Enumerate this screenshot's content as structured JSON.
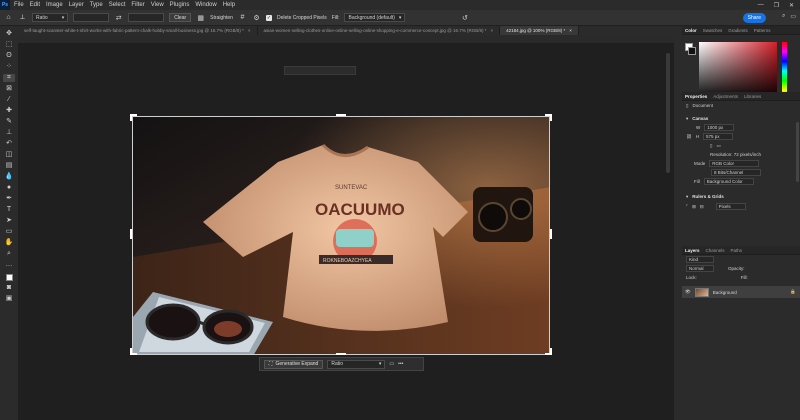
{
  "menubar": {
    "logo": "Ps",
    "items": [
      "File",
      "Edit",
      "Image",
      "Layer",
      "Type",
      "Select",
      "Filter",
      "View",
      "Plugins",
      "Window",
      "Help"
    ],
    "controls": [
      "—",
      "❐",
      "✕"
    ]
  },
  "options": {
    "ratio_label": "Ratio",
    "clear_label": "Clear",
    "straighten_label": "Straighten",
    "delete_cropped_label": "Delete Cropped Pixels",
    "fill_label": "Fill:",
    "fill_value": "Background (default)",
    "share_label": "Share"
  },
  "tabs": [
    {
      "label": "self-taught-scanster-white-t-shirt-works-with-fabric-pattern-chalk-hobby-small-business.jpg @ 16.7% (RGB/8) *",
      "active": false
    },
    {
      "label": "asian-women-selling-clothes-online-online-selling-online-shopping-e-commerce-concept.jpg @ 16.7% (RGB/8) *",
      "active": false
    },
    {
      "label": "42184.jpg @ 100% (RGB/8) *",
      "active": true
    }
  ],
  "tab_close": "×",
  "canvas": {
    "shirt_text_top": "SUNTEVAC",
    "shirt_text_main": "OACUUMO",
    "shirt_text_band": "ROKNEBOAZCHYEA"
  },
  "genbar": {
    "button_label": "Generative Expand",
    "ratio_value": "Ratio",
    "more": "•••"
  },
  "panels": {
    "color_tabs": [
      "Color",
      "Swatches",
      "Gradients",
      "Patterns"
    ],
    "props_tabs": [
      "Properties",
      "Adjustments",
      "Libraries"
    ],
    "document_label": "Document",
    "canvas_header": "Canvas",
    "width_label": "W",
    "width_value": "1000 px",
    "height_label": "H",
    "height_value": "575 px",
    "resolution": "Resolution: 72 pixels/inch",
    "mode_label": "Mode",
    "mode_value": "RGB Color",
    "depth_value": "8 Bits/Channel",
    "fill_label": "Fill",
    "fill_value": "Background Color",
    "rulers_header": "Rulers & Grids",
    "rulers_units": "Pixels",
    "layers_tabs": [
      "Layers",
      "Channels",
      "Paths"
    ],
    "layers_kind": "Kind",
    "layers_mode": "Normal",
    "layers_opacity": "Opacity:",
    "layers_lock": "Lock:",
    "layers_fill": "Fill:",
    "layer_name": "Background"
  }
}
